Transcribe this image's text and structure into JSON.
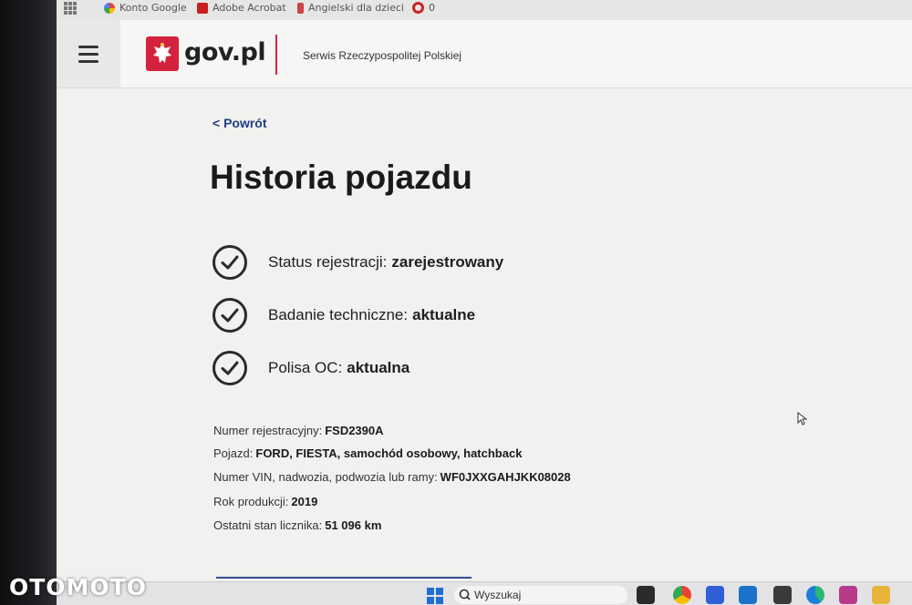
{
  "bookmarks": [
    {
      "label": "Konto Google",
      "icon": "google-icon"
    },
    {
      "label": "Adobe Acrobat",
      "icon": "acrobat-icon"
    },
    {
      "label": "Angielski dla dzieci",
      "icon": "bookmark-icon"
    },
    {
      "label": "0",
      "icon": "opera-icon"
    }
  ],
  "header": {
    "logo": "gov.pl",
    "service": "Serwis Rzeczypospolitej Polskiej"
  },
  "back_link": "< Powrót",
  "title": "Historia pojazdu",
  "statuses": [
    {
      "label": "Status rejestracji:",
      "value": "zarejestrowany"
    },
    {
      "label": "Badanie techniczne:",
      "value": "aktualne"
    },
    {
      "label": "Polisa OC:",
      "value": "aktualna"
    }
  ],
  "details": [
    {
      "label": "Numer rejestracyjny:",
      "value": "FSD2390A"
    },
    {
      "label": "Pojazd:",
      "value": "FORD, FIESTA, samochód osobowy, hatchback"
    },
    {
      "label": "Numer VIN, nadwozia, podwozia lub ramy:",
      "value": "WF0JXXGAHJKK08028"
    },
    {
      "label": "Rok produkcji:",
      "value": "2019"
    },
    {
      "label": "Ostatni stan licznika:",
      "value": "51 096 km"
    }
  ],
  "taskbar": {
    "search_label": "Wyszukaj"
  },
  "watermark": "OTOMOTO",
  "colors": {
    "accent_red": "#d4213d",
    "link_blue": "#1f3f83"
  }
}
